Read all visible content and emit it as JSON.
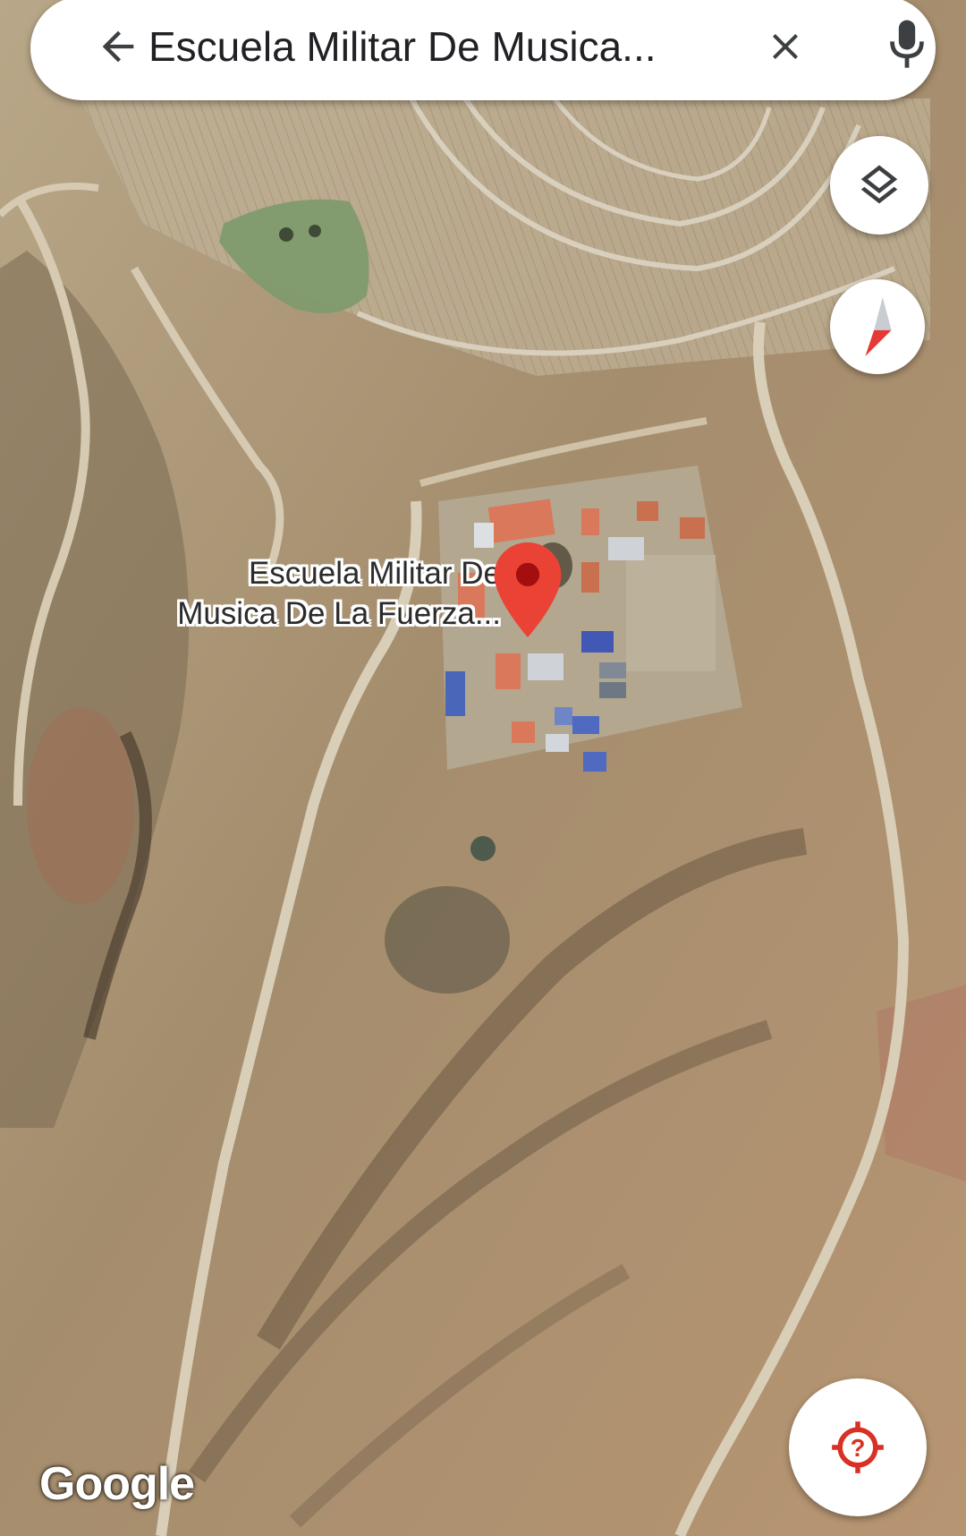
{
  "search": {
    "query": "Escuela Militar De Musica...",
    "back_icon": "arrow-back-icon",
    "clear_icon": "close-icon",
    "mic_icon": "microphone-icon"
  },
  "controls": {
    "layers_icon": "layers-icon",
    "compass_icon": "compass-icon",
    "locate_icon": "location-unknown-icon"
  },
  "place": {
    "label_line1": "Escuela Militar De",
    "label_line2": "Musica De La Fuerza...",
    "pin_color": "#ea4335"
  },
  "map": {
    "view": "satellite",
    "attribution": "Google"
  }
}
